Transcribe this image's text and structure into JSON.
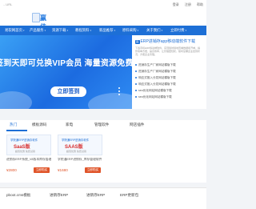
{
  "topbar": {
    "left_text": "...URL",
    "links": [
      "登录",
      "注册",
      "帮助"
    ]
  },
  "logo": {
    "word": "赢佳"
  },
  "nav": {
    "items": [
      {
        "label": "易软网首页",
        "arrow": "▾"
      },
      {
        "label": "产品服务",
        "arrow": "▾"
      },
      {
        "label": "资源下载",
        "arrow": "▾"
      },
      {
        "label": "教程资料",
        "arrow": "▾"
      },
      {
        "label": "新品推荐",
        "arrow": "▾"
      },
      {
        "label": "原料采购",
        "arrow": "▾"
      },
      {
        "label": "关于我们",
        "arrow": "▾"
      },
      {
        "label": "立即付费",
        "arrow": "▾"
      }
    ]
  },
  "banner": {
    "headline": "签到天即可兑换VIP会员 海量资源免费下载",
    "button": "立即签到"
  },
  "side": {
    "badge": "赢",
    "title": "ERP进销存app移动端软件下载",
    "desc": "下载手机ERP移动端软件，实现随时随地查看数据和开单，操作简单方便，提高效率，让管理更轻松，随时掌握企业经营状况，方便企业管理。",
    "items": [
      "进销存生产厂家网站模版下载",
      "进销存生产厂家网站模版下载",
      "响应式推入分发网站模版下载",
      "响应式推入分发网站模版下载",
      "seo优化网站网站模版下载",
      "seo优化网站网站模版下载"
    ]
  },
  "tabs": {
    "items": [
      "热门",
      "模板源码",
      "家电",
      "管理软件",
      "网店插件"
    ],
    "active_index": 0
  },
  "products": [
    {
      "thumb_line1": "学院通ERP进销存软件",
      "thumb_line2": "SaaS版",
      "thumb_line3": "超值优惠 免费试用",
      "name": "进销存ERP系统_V8版本库存管理",
      "price": "¥2800",
      "buy": "立即购买"
    },
    {
      "thumb_line1": "学院通ERP进销存软件",
      "thumb_line2": "SAAS版",
      "thumb_line3": "超值优惠 免费试用",
      "name": "学院通ERP进销存_库存管理软件",
      "price": "¥1680",
      "buy": "立即购买"
    }
  ],
  "bottom": {
    "items": [
      "pboot.cms模板",
      "进销存ERP",
      "进销存ERP",
      "ERP更新包"
    ]
  }
}
